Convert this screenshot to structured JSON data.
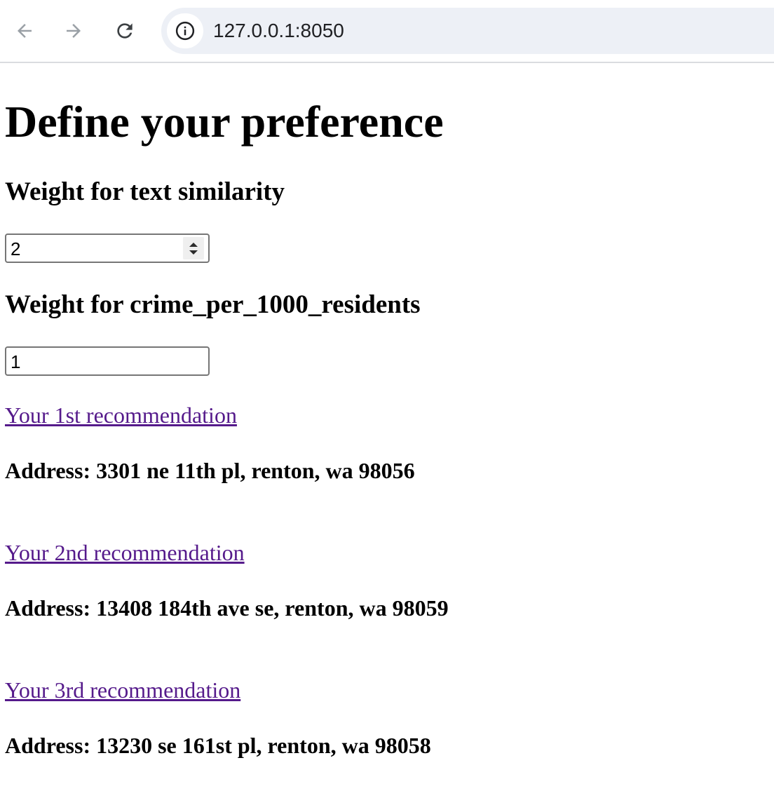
{
  "browser": {
    "url": "127.0.0.1:8050",
    "back_icon": "arrow-left-icon",
    "forward_icon": "arrow-right-icon",
    "reload_icon": "reload-icon",
    "site_info_icon": "info-icon"
  },
  "page": {
    "title": "Define your preference",
    "text_similarity": {
      "label": "Weight for text similarity",
      "value": "2"
    },
    "crime": {
      "label": "Weight for crime_per_1000_residents",
      "value": "1"
    },
    "recommendations": [
      {
        "link": "Your 1st recommendation",
        "address": "Address: 3301 ne 11th pl, renton, wa 98056"
      },
      {
        "link": "Your 2nd recommendation",
        "address": "Address: 13408 184th ave se, renton, wa 98059"
      },
      {
        "link": "Your 3rd recommendation",
        "address": "Address: 13230 se 161st pl, renton, wa 98058"
      }
    ],
    "link_color": "#551a8b"
  }
}
